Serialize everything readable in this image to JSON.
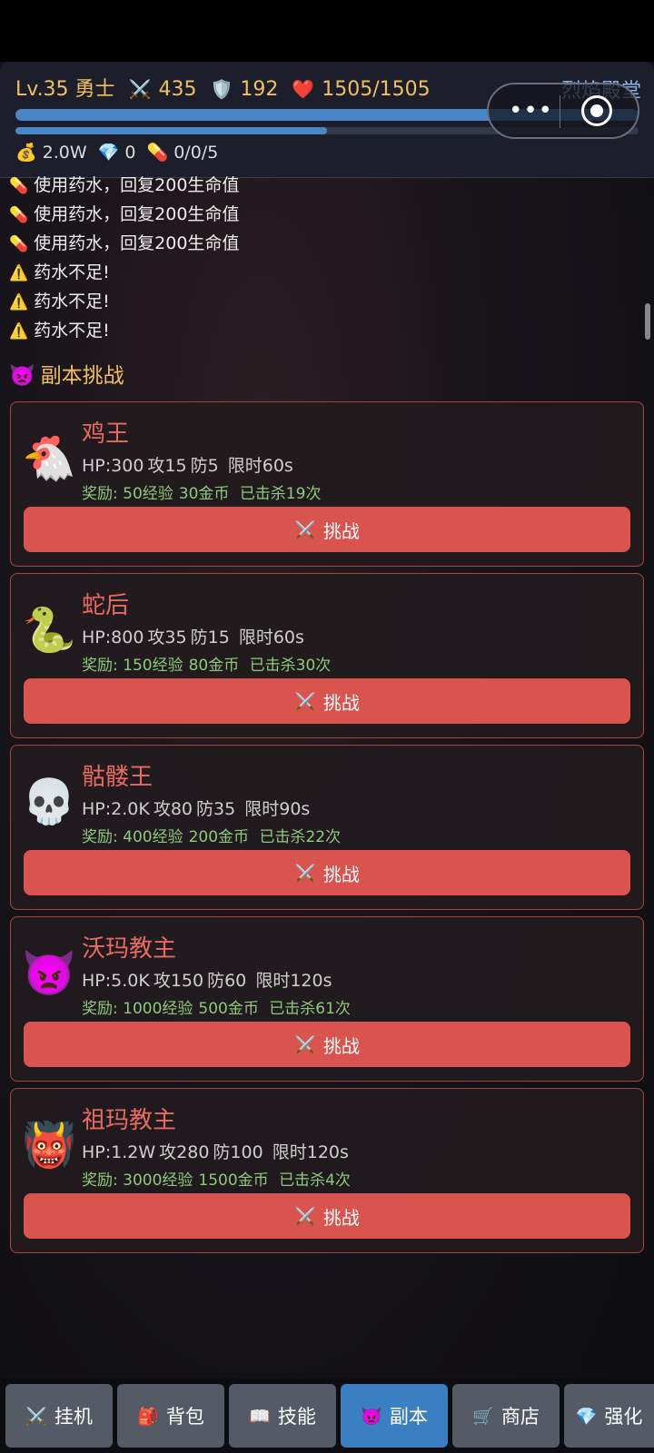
{
  "header": {
    "level": "Lv.35 勇士",
    "attack": "435",
    "defense": "192",
    "hp": "1505/1505",
    "location": "烈焰殿堂",
    "hp_fraction": 1.0,
    "exp_fraction": 0.5,
    "gold": "2.0W",
    "diamonds": "0",
    "potions": "0/0/5",
    "icons": {
      "attack": "crossed-swords-icon",
      "defense": "shield-icon",
      "hp": "heart-icon",
      "gold": "money-bag-icon",
      "diamond": "gem-icon",
      "potion": "pill-icon"
    }
  },
  "log": [
    {
      "icon": "💊",
      "text": "使用药水，回复200生命值"
    },
    {
      "icon": "💊",
      "text": "使用药水，回复200生命值"
    },
    {
      "icon": "💊",
      "text": "使用药水，回复200生命值"
    },
    {
      "icon": "⚠️",
      "text": "药水不足!"
    },
    {
      "icon": "⚠️",
      "text": "药水不足!"
    },
    {
      "icon": "⚠️",
      "text": "药水不足!"
    }
  ],
  "section": {
    "icon": "👿",
    "title": "副本挑战"
  },
  "dungeons": [
    {
      "icon": "🐔",
      "name": "鸡王",
      "hp": "HP:300",
      "atk": "攻15",
      "def": "防5",
      "time": "限时60s",
      "reward_exp": "奖励: 50经验",
      "reward_gold": "30金币",
      "kills": "已击杀19次",
      "button": "挑战"
    },
    {
      "icon": "🐍",
      "name": "蛇后",
      "hp": "HP:800",
      "atk": "攻35",
      "def": "防15",
      "time": "限时60s",
      "reward_exp": "奖励: 150经验",
      "reward_gold": "80金币",
      "kills": "已击杀30次",
      "button": "挑战"
    },
    {
      "icon": "💀",
      "name": "骷髅王",
      "hp": "HP:2.0K",
      "atk": "攻80",
      "def": "防35",
      "time": "限时90s",
      "reward_exp": "奖励: 400经验",
      "reward_gold": "200金币",
      "kills": "已击杀22次",
      "button": "挑战"
    },
    {
      "icon": "👿",
      "name": "沃玛教主",
      "hp": "HP:5.0K",
      "atk": "攻150",
      "def": "防60",
      "time": "限时120s",
      "reward_exp": "奖励: 1000经验",
      "reward_gold": "500金币",
      "kills": "已击杀61次",
      "button": "挑战"
    },
    {
      "icon": "👹",
      "name": "祖玛教主",
      "hp": "HP:1.2W",
      "atk": "攻280",
      "def": "防100",
      "time": "限时120s",
      "reward_exp": "奖励: 3000经验",
      "reward_gold": "1500金币",
      "kills": "已击杀4次",
      "button": "挑战"
    }
  ],
  "tabs": [
    {
      "icon": "⚔️",
      "label": "挂机",
      "active": false
    },
    {
      "icon": "🎒",
      "label": "背包",
      "active": false
    },
    {
      "icon": "📖",
      "label": "技能",
      "active": false
    },
    {
      "icon": "👿",
      "label": "副本",
      "active": true
    },
    {
      "icon": "🛒",
      "label": "商店",
      "active": false
    },
    {
      "icon": "💎",
      "label": "强化",
      "active": false
    }
  ],
  "colors": {
    "accent_blue": "#3b7fc3",
    "danger_red": "#d9534f",
    "gold_text": "#f0c060",
    "reward_green": "#8fca7c"
  }
}
